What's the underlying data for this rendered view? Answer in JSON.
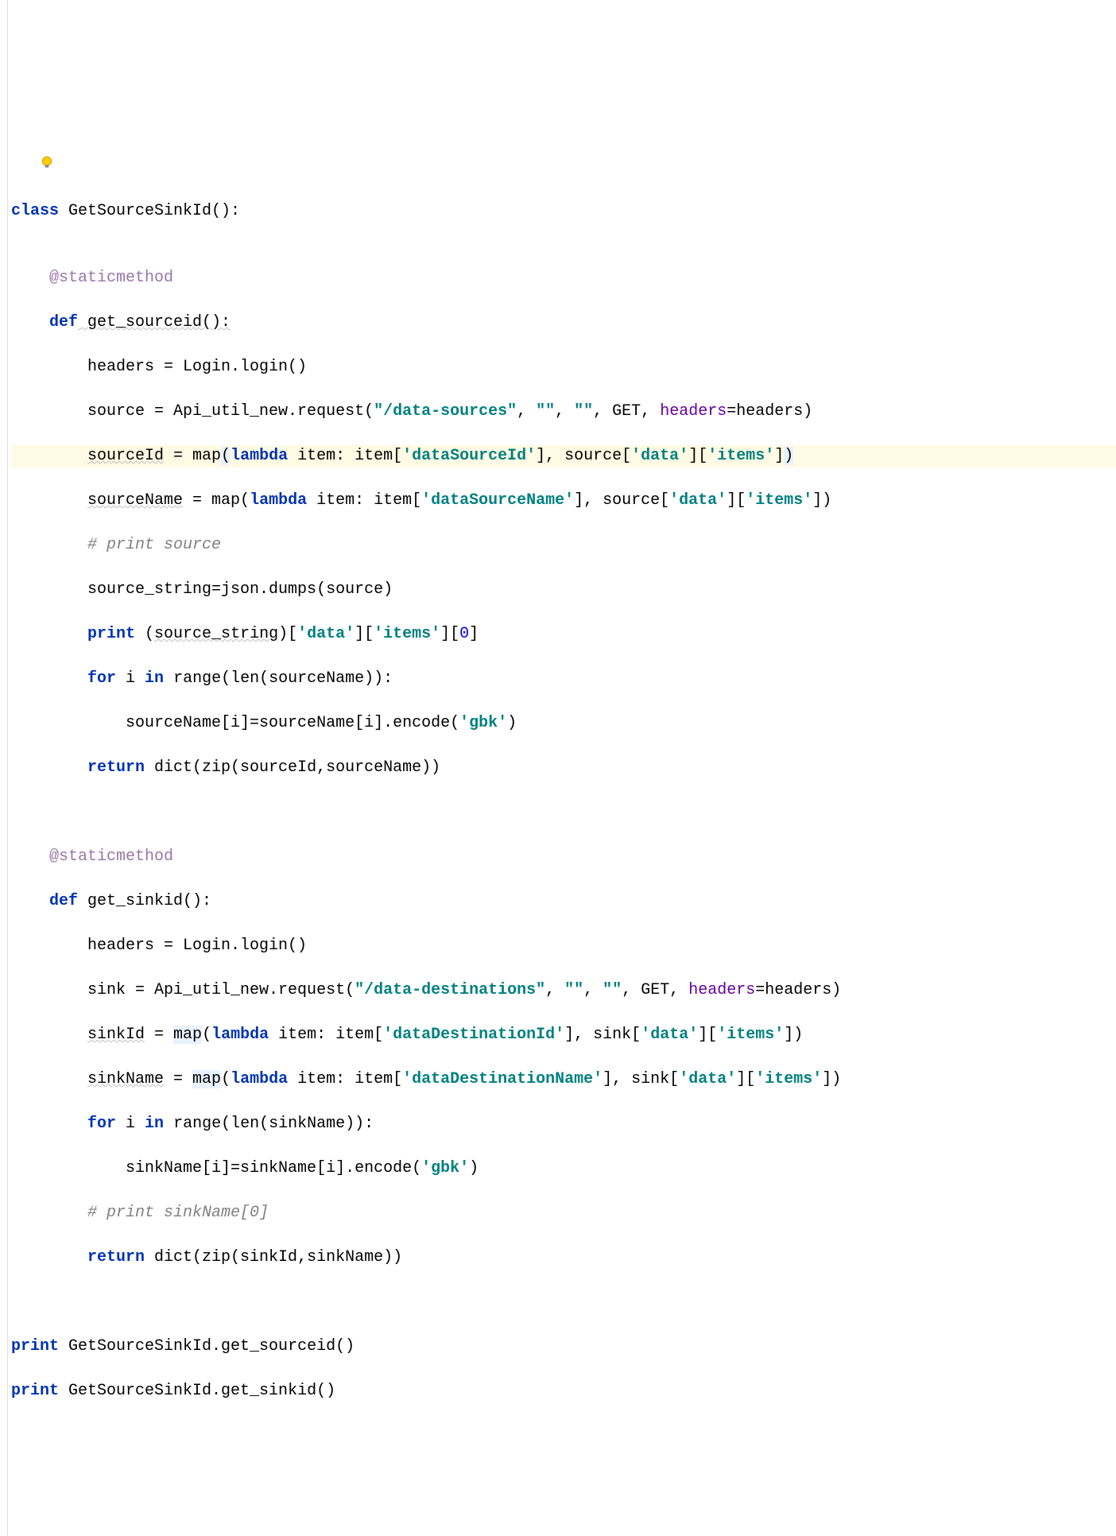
{
  "lines": {
    "l1_class": "class",
    "l1_name": " GetSourceSinkId():",
    "l2": "",
    "l3_dec": "    @staticmethod",
    "l4_def": "    def",
    "l4_name": " get_sourceid():",
    "l5_a": "        headers = Login.login()",
    "l6_a": "        source = Api_util_new.request(",
    "l6_s1": "\"/data-sources\"",
    "l6_b": ", ",
    "l6_s2": "\"\"",
    "l6_c": ", ",
    "l6_s3": "\"\"",
    "l6_d": ", GET, ",
    "l6_param": "headers",
    "l6_e": "=headers)",
    "l7_a": "        ",
    "l7_var": "sourceId",
    "l7_b": " = map",
    "l7_paren": "(",
    "l7_lambda": "lambda",
    "l7_c": " item: item[",
    "l7_s1": "'dataSourceId'",
    "l7_d": "], source[",
    "l7_s2": "'data'",
    "l7_e": "][",
    "l7_s3": "'items'",
    "l7_f": "]",
    "l7_paren2": ")",
    "l8_a": "        ",
    "l8_var": "sourceName",
    "l8_b": " = map(",
    "l8_lambda": "lambda",
    "l8_c": " item: item[",
    "l8_s1": "'dataSourceName'",
    "l8_d": "], source[",
    "l8_s2": "'data'",
    "l8_e": "][",
    "l8_s3": "'items'",
    "l8_f": "])",
    "l9_comment": "        # print source",
    "l10_a": "        source_string=json.dumps(source)",
    "l11_print": "        print",
    "l11_a": " (",
    "l11_var": "source_string",
    "l11_b": ")[",
    "l11_s1": "'data'",
    "l11_c": "][",
    "l11_s2": "'items'",
    "l11_d": "][",
    "l11_num": "0",
    "l11_e": "]",
    "l12_for": "        for",
    "l12_a": " i ",
    "l12_in": "in",
    "l12_b": " range(len(sourceName)):",
    "l13_a": "            sourceName[i]=sourceName[i].encode(",
    "l13_s": "'gbk'",
    "l13_b": ")",
    "l14_ret": "        return",
    "l14_a": " dict(zip(sourceId,sourceName))",
    "l15": "",
    "l16": "",
    "l17_dec": "    @staticmethod",
    "l18_def": "    def",
    "l18_name": " get_sinkid():",
    "l19_a": "        headers = Login.login()",
    "l20_a": "        sink = Api_util_new.request(",
    "l20_s1": "\"/data-destinations\"",
    "l20_b": ", ",
    "l20_s2": "\"\"",
    "l20_c": ", ",
    "l20_s3": "\"\"",
    "l20_d": ", GET, ",
    "l20_param": "headers",
    "l20_e": "=headers)",
    "l21_a": "        ",
    "l21_var": "sinkId",
    "l21_b": " = ",
    "l21_map": "map",
    "l21_c": "(",
    "l21_lambda": "lambda",
    "l21_d": " item: item[",
    "l21_s1": "'dataDestinationId'",
    "l21_e": "], sink[",
    "l21_s2": "'data'",
    "l21_f": "][",
    "l21_s3": "'items'",
    "l21_g": "])",
    "l22_a": "        ",
    "l22_var": "sinkName",
    "l22_b": " = ",
    "l22_map": "map",
    "l22_c": "(",
    "l22_lambda": "lambda",
    "l22_d": " item: item[",
    "l22_s1": "'dataDestinationName'",
    "l22_e": "], sink[",
    "l22_s2": "'data'",
    "l22_f": "][",
    "l22_s3": "'items'",
    "l22_g": "])",
    "l23_for": "        for",
    "l23_a": " i ",
    "l23_in": "in",
    "l23_b": " range(len(sinkName)):",
    "l24_a": "            sinkName[i]=sinkName[i].encode(",
    "l24_s": "'gbk'",
    "l24_b": ")",
    "l25_comment": "        # print sinkName[0]",
    "l26_ret": "        return",
    "l26_a": " dict(zip(sinkId,sinkName))",
    "l27": "",
    "l28": "",
    "l29_print": "print",
    "l29_a": " GetSourceSinkId.get_sourceid()",
    "l30_print": "print",
    "l30_a": " GetSourceSinkId.get_sinkid()"
  }
}
